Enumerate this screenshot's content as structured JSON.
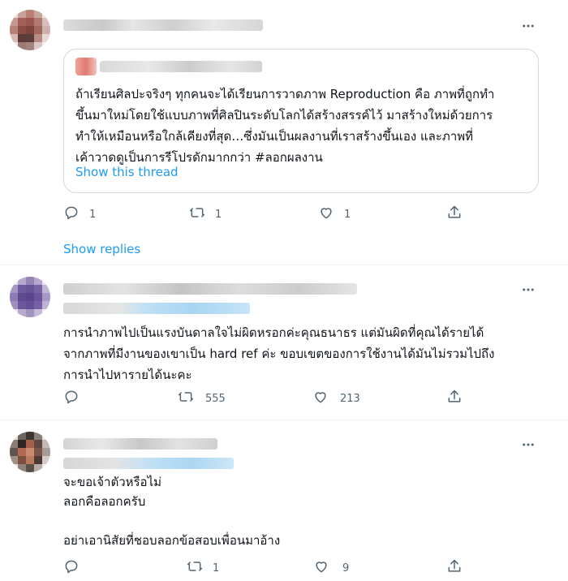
{
  "tweets": [
    {
      "quote": {
        "text_lines": [
          "ถ้าเรียนศิลปะจริงๆ ทุกคนจะได้เรียนการวาดภาพ Reproduction คือ ภาพที่ถูกทำ",
          "ขึ้นมาใหม่โดยใช้แบบภาพที่ศิลปินระดับโลกได้สร้างสรรค์ไว้ มาสร้างใหม่ด้วยการ",
          "ทำให้เหมือนหรือใกล้เคียงที่สุด…ซึ่งมันเป็นผลงานที่เราสร้างขึ้นเอง และภาพที่",
          "เค้าวาดดูเป็นการรีโปรดักมากกว่า #ลอกผลงาน"
        ],
        "show_thread": "Show this thread"
      },
      "actions": {
        "replies": "1",
        "retweets": "1",
        "likes": "1"
      },
      "show_replies": "Show replies"
    },
    {
      "text_lines": [
        "การนำภาพไปเป็นแรงบันดาลใจไม่ผิดหรอกค่ะคุณธนาธร แต่มันผิดที่คุณได้รายได้",
        "จากภาพที่มีงานของเขาเป็น hard ref ค่ะ ขอบเขตของการใช้งานได้มันไม่รวมไปถึง",
        "การนำไปหารายได้นะคะ"
      ],
      "actions": {
        "replies": "",
        "retweets": "555",
        "likes": "213"
      }
    },
    {
      "text_lines": [
        "จะขอเจ้าตัวหรือไม่",
        "ลอกคือลอกครับ",
        "",
        "อย่าเอานิสัยที่ชอบลอกข้อสอบเพื่อนมาอ้าง"
      ],
      "actions": {
        "replies": "",
        "retweets": "1",
        "likes": "9"
      }
    }
  ],
  "colors": {
    "text": "#0f1419",
    "muted": "#536471",
    "link": "#1d9bf0",
    "border": "#cfd9de"
  }
}
